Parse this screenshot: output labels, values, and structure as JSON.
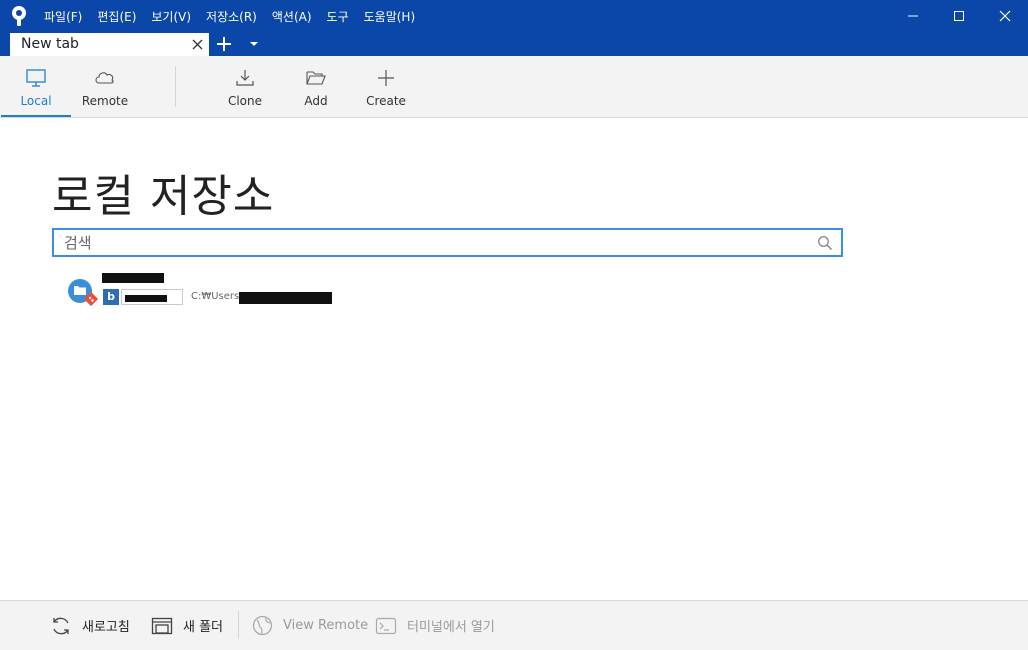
{
  "titlebar": {
    "menu": [
      "파일(F)",
      "편집(E)",
      "보기(V)",
      "저장소(R)",
      "액션(A)",
      "도구",
      "도움말(H)"
    ],
    "brand_color": "#0a47a9"
  },
  "tabs": [
    {
      "label": "New tab"
    }
  ],
  "toolbar": {
    "local_label": "Local",
    "remote_label": "Remote",
    "clone_label": "Clone",
    "add_label": "Add",
    "create_label": "Create",
    "accent_color": "#1e7fd1"
  },
  "main": {
    "title": "로컬 저장소",
    "search_placeholder": "검색",
    "repos": [
      {
        "path_prefix": "C:₩Users₩",
        "badge": "b"
      }
    ]
  },
  "statusbar": {
    "refresh_label": "새로고침",
    "new_folder_label": "새 폴더",
    "view_remote_label": "View Remote",
    "open_terminal_label": "터미널에서 열기"
  }
}
